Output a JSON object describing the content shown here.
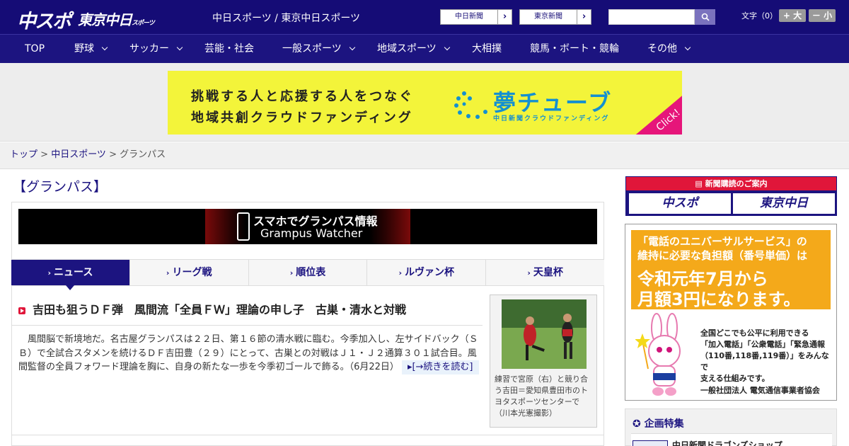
{
  "header": {
    "logo_chunichi": "中スポ",
    "logo_tokyo": "東京中日",
    "logo_tokyo_small": "スポーツ",
    "site_title": "中日スポーツ / 東京中日スポーツ",
    "paper1": "中日新聞",
    "paper2": "東京新聞",
    "font_label": "文字（0）",
    "font_bigger": "+ 大",
    "font_smaller": "－ 小"
  },
  "nav": [
    "TOP",
    "野球",
    "サッカー",
    "芸能・社会",
    "一般スポーツ",
    "地域スポーツ",
    "大相撲",
    "競馬・ボート・競輪",
    "その他"
  ],
  "ad": {
    "line1": "挑戦する人と応援する人をつなぐ",
    "line2": "地域共創クラウドファンディング",
    "brand": "夢チューブ",
    "sub": "中日新聞クラウドファンディング",
    "click": "Click!"
  },
  "breadcrumb": {
    "home": "トップ",
    "section": "中日スポーツ",
    "current": "グランパス",
    "sep": " > "
  },
  "section_title": "【グランパス】",
  "banner": {
    "line1": "スマホでグランパス情報",
    "line2": "Grampus Watcher"
  },
  "tabs": [
    "ニュース",
    "リーグ戦",
    "順位表",
    "ルヴァン杯",
    "天皇杯"
  ],
  "article": {
    "title": "吉田も狙うＤＦ弾　風間流「全員ＦＷ」理論の申し子　古巣・清水と対戦",
    "body": "　風間脳で新境地だ。名古屋グランパスは２２日、第１６節の清水戦に臨む。今季加入し、左サイドバック（ＳＢ）で全試合スタメンを続けるＤＦ吉田豊（２９）にとって、古巣との対戦はＪ１・Ｊ２通算３０１試合目。風間監督の全員フォワード理論を胸に、自身の新たな一歩を今季初ゴールで飾る。（6月22日）",
    "more": "[→続きを読む]",
    "caption": "練習で宮原（右）と競り合う吉田＝愛知県豊田市のトヨタスポーツセンターで（川本光憲撮影）"
  },
  "sidebar": {
    "subscribe": "新聞購読のご案内",
    "sub_logo1": "中スポ",
    "sub_logo2": "東京中日",
    "uni_l1": "「電話のユニバーサルサービス」の",
    "uni_l1b": "維持に必要な負担額（番号単価）は",
    "uni_l2": "令和元年7月から",
    "uni_l3": "月額3円になります。",
    "uni_t1": "全国どこでも公平に利用できる",
    "uni_t2": "「加入電話」「公衆電話」「緊急通報",
    "uni_t3": "（110番,118番,119番）」をみんなで",
    "uni_t4": "支える仕組みです。",
    "uni_org": "一般社団法人 電気通信事業者協会",
    "kikaku": "企画特集",
    "kikaku_item": "中日新聞ドラゴンズショップ"
  },
  "colors": {
    "navy": "#1c1480",
    "red": "#e0163a",
    "ad_yellow": "#f3f43a"
  }
}
